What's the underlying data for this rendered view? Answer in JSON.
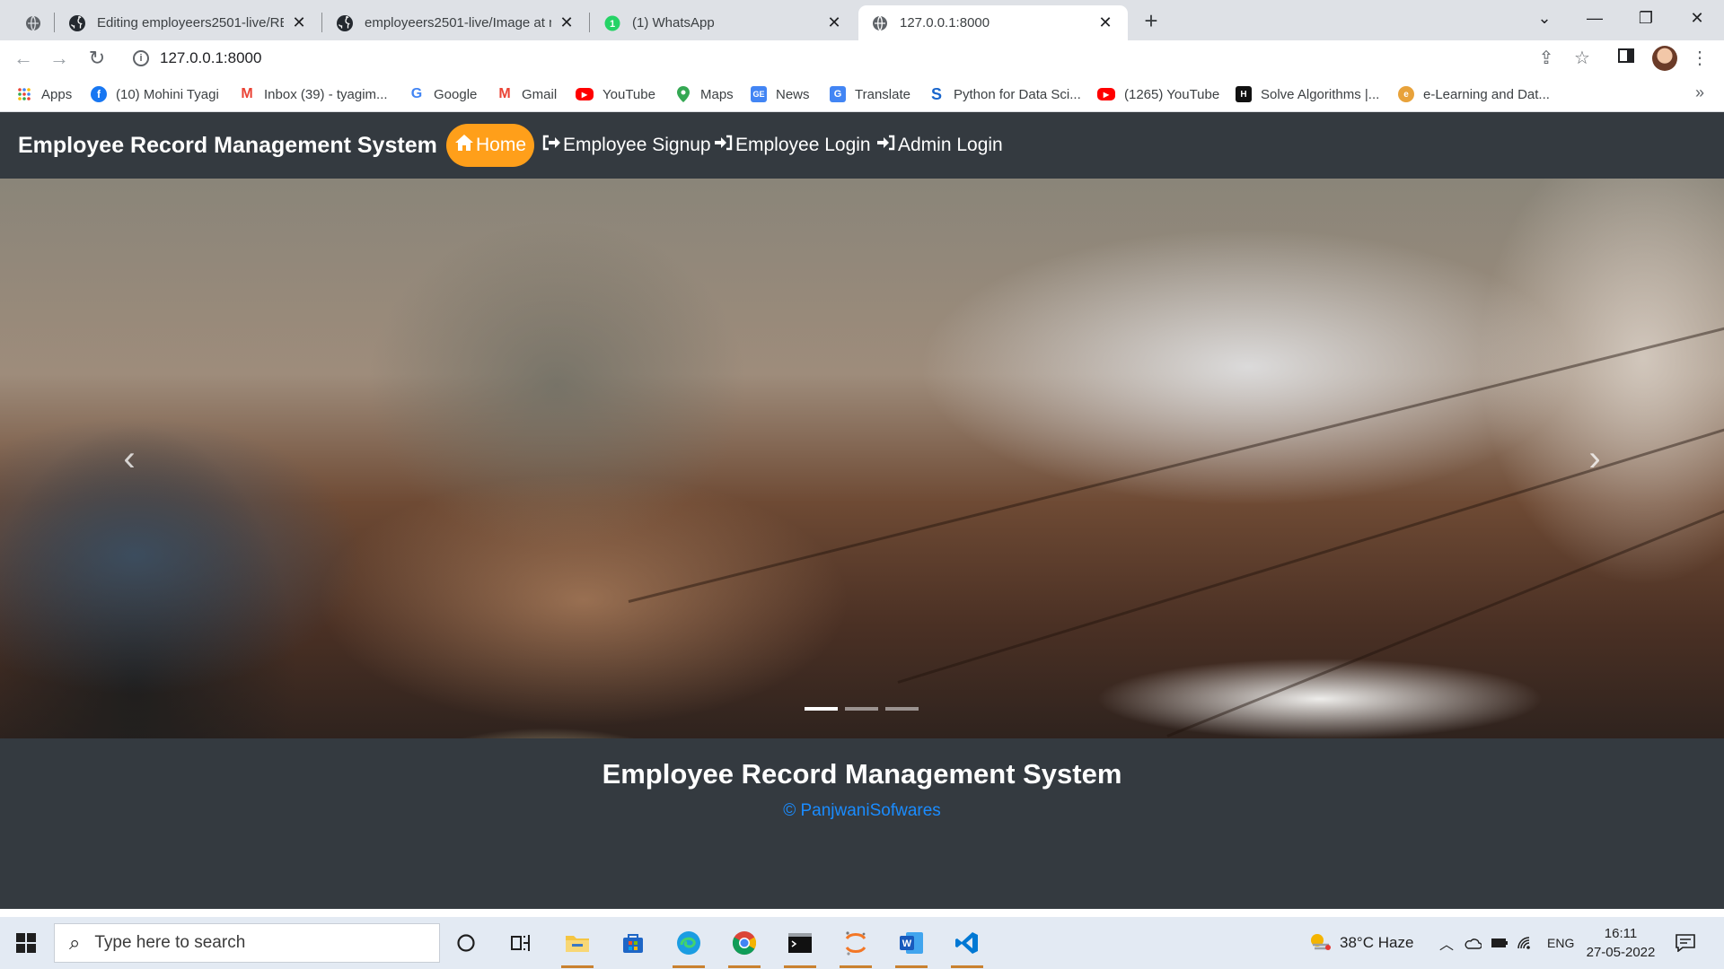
{
  "browser": {
    "tabs": [
      {
        "title": "",
        "favicon": "globe-icon",
        "active": false
      },
      {
        "title": "Editing employeers2501-live/REA",
        "favicon": "github-icon",
        "active": false
      },
      {
        "title": "employeers2501-live/Image at m",
        "favicon": "github-icon",
        "active": false
      },
      {
        "title": "(1) WhatsApp",
        "favicon": "whatsapp-icon",
        "active": false
      },
      {
        "title": "127.0.0.1:8000",
        "favicon": "globe-icon",
        "active": true
      }
    ],
    "address": "127.0.0.1:8000",
    "bookmarks": [
      {
        "label": "Apps",
        "icon": "apps-grid-icon"
      },
      {
        "label": "(10) Mohini Tyagi",
        "icon": "facebook-icon"
      },
      {
        "label": "Inbox (39) - tyagim...",
        "icon": "gmail-icon"
      },
      {
        "label": "Google",
        "icon": "google-icon"
      },
      {
        "label": "Gmail",
        "icon": "gmail-icon"
      },
      {
        "label": "YouTube",
        "icon": "youtube-icon"
      },
      {
        "label": "Maps",
        "icon": "maps-icon"
      },
      {
        "label": "News",
        "icon": "news-icon"
      },
      {
        "label": "Translate",
        "icon": "translate-icon"
      },
      {
        "label": "Python for Data Sci...",
        "icon": "s-icon"
      },
      {
        "label": "(1265) YouTube",
        "icon": "youtube-icon"
      },
      {
        "label": "Solve Algorithms |...",
        "icon": "hackerrank-icon"
      },
      {
        "label": "e-Learning and Dat...",
        "icon": "elearning-icon"
      }
    ],
    "more_bookmarks": "»"
  },
  "site": {
    "brand": "Employee Record Management System",
    "nav": [
      {
        "label": "Home",
        "icon": "home-icon",
        "active": true
      },
      {
        "label": "Employee Signup",
        "icon": "sign-out-icon",
        "active": false
      },
      {
        "label": "Employee Login",
        "icon": "sign-in-icon",
        "active": false
      },
      {
        "label": "Admin Login",
        "icon": "sign-in-icon",
        "active": false
      }
    ],
    "carousel": {
      "slide_count": 3,
      "active_slide": 1
    },
    "footer": {
      "title": "Employee Record Management System",
      "copyright": "© PanjwaniSofwares"
    }
  },
  "taskbar": {
    "search_placeholder": "Type here to search",
    "weather": "38°C  Haze",
    "language": "ENG",
    "time": "16:11",
    "date": "27-05-2022"
  },
  "colors": {
    "navbar_bg": "#343a40",
    "active_pill": "#ff9f1a",
    "footer_link": "#1a8cff"
  }
}
